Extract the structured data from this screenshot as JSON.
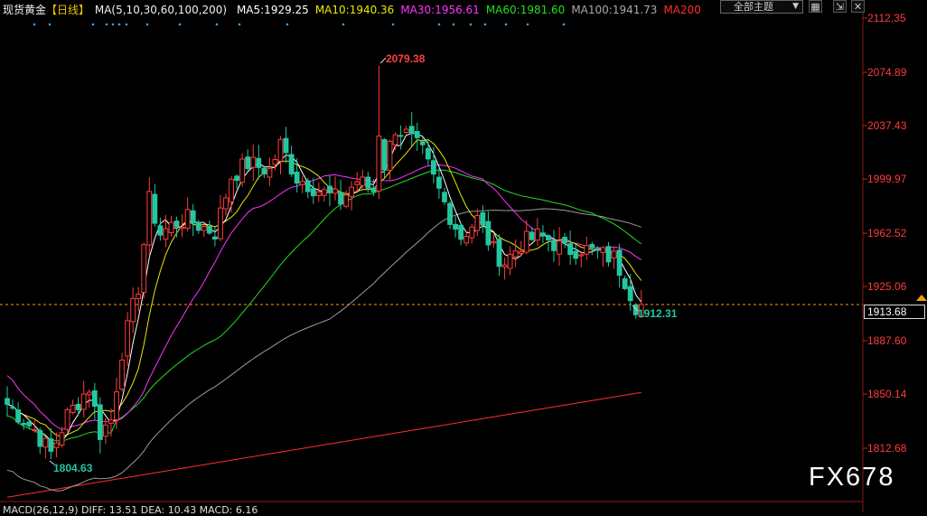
{
  "header": {
    "instrument": "现货黄金",
    "period": "【日线】",
    "ma_params": "MA(5,10,30,60,100,200)",
    "ma_values": [
      {
        "label": "MA5:1929.25",
        "color": "#ffffff"
      },
      {
        "label": "MA10:1940.36",
        "color": "#e8e800"
      },
      {
        "label": "MA30:1956.61",
        "color": "#ff33ff"
      },
      {
        "label": "MA60:1981.60",
        "color": "#22dd22"
      },
      {
        "label": "MA100:1941.73",
        "color": "#aaaaaa"
      },
      {
        "label": "MA200",
        "color": "#ff2d2d"
      }
    ]
  },
  "toolbar": {
    "theme_select": "全部主题",
    "icons": [
      "grid-icon",
      "arrows-icon",
      "close-icon"
    ]
  },
  "price_axis": {
    "ticks": [
      "2112.35",
      "2074.89",
      "2037.43",
      "1999.97",
      "1962.52",
      "1925.06",
      "1887.60",
      "1850.14",
      "1812.68"
    ],
    "current_price": "1913.68",
    "color": "#ff3b3b"
  },
  "annotations": {
    "high": "2079.38",
    "low": "1804.63",
    "last_low": "1912.31"
  },
  "macd": {
    "text": "MACD(26,12,9) DIFF: 13.51  DEA: 10.43  MACD: 6.16"
  },
  "watermark": "FX678",
  "colors": {
    "up": "#ff3b3b",
    "down": "#22c7a0",
    "bg": "#000000"
  }
}
